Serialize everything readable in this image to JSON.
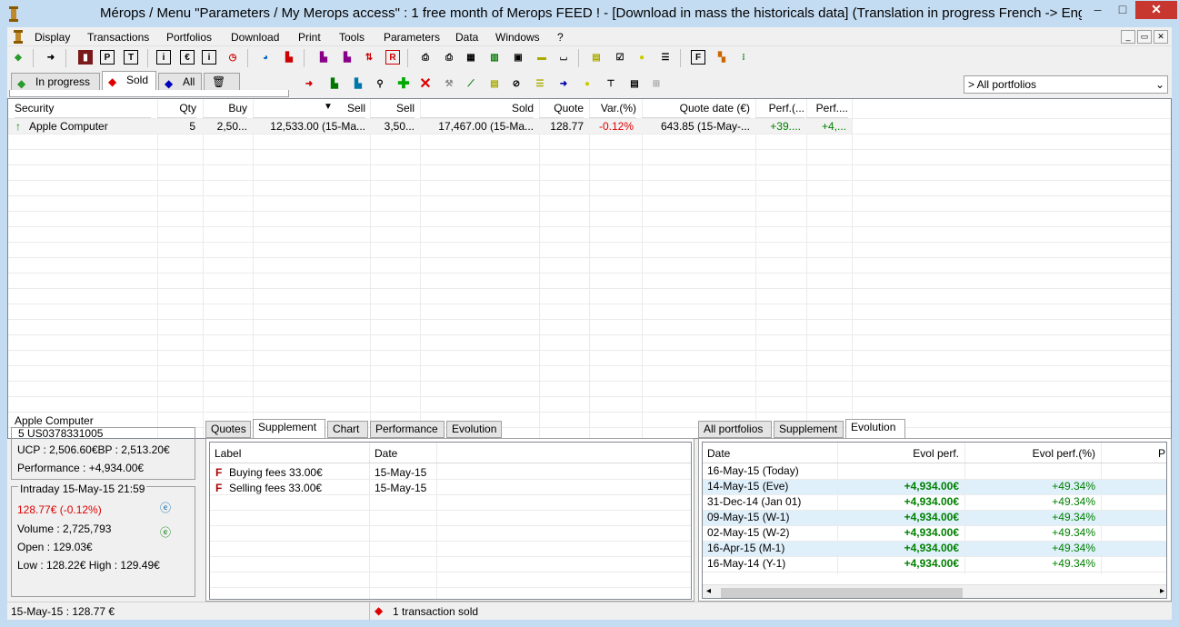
{
  "window": {
    "title": "Mérops / Menu \"Parameters / My Merops access\" : 1 free month of Merops FEED ! - [Download in mass the historicals data] (Translation in progress French -> Engl",
    "min_label": "–",
    "max_label": "□",
    "close_label": "✕"
  },
  "menu": [
    "Display",
    "Transactions",
    "Portfolios",
    "Download",
    "Print",
    "Tools",
    "Parameters",
    "Data",
    "Windows",
    "?"
  ],
  "mdi": {
    "min": "_",
    "restore": "▭",
    "close": "✕"
  },
  "tabs": [
    {
      "label": "In progress"
    },
    {
      "label": "Sold"
    },
    {
      "label": "All"
    }
  ],
  "portfolio_select": {
    "value": "> All portfolios"
  },
  "grid": {
    "headers": [
      "Security",
      "Qty",
      "Buy",
      "",
      "Sell",
      "Sell",
      "Sold",
      "Quote",
      "Var.(%)",
      "Quote date (€)",
      "Perf.(...",
      "Perf...."
    ],
    "row": {
      "security": "Apple Computer",
      "qty": "5",
      "buy": "2,50...",
      "buy_total": "12,533.00 (15-Ma...",
      "sell": "3,50...",
      "sold": "17,467.00 (15-Ma...",
      "quote": "128.77",
      "var": "-0.12%",
      "quote_date": "643.85 (15-May-...",
      "perf1": "+39....",
      "perf2": "+4,..."
    }
  },
  "info": {
    "name": "Apple Computer",
    "isin": "5 US0378331005",
    "ucp": "UCP : 2,506.60€BP : 2,513.20€",
    "performance": "Performance : +4,934.00€",
    "intraday": "Intraday 15-May-15 21:59",
    "quote": "128.77€ (-0.12%)",
    "volume": "Volume : 2,725,793",
    "open": "Open : 129.03€",
    "lowhigh": "Low : 128.22€ High : 129.49€"
  },
  "mid_tabs": [
    "Quotes",
    "Supplement",
    "Chart",
    "Performance",
    "Evolution"
  ],
  "mid_table": {
    "headers": [
      "Label",
      "Date"
    ],
    "rows": [
      {
        "label": "Buying fees 33.00€",
        "date": "15-May-15"
      },
      {
        "label": "Selling fees 33.00€",
        "date": "15-May-15"
      }
    ]
  },
  "right_tabs": [
    "All portfolios",
    "Supplement",
    "Evolution"
  ],
  "right_table": {
    "headers": [
      "Date",
      "Evol perf.",
      "Evol perf.(%)",
      "P"
    ],
    "rows": [
      {
        "date": "16-May-15 (Today)",
        "evol": "",
        "pct": ""
      },
      {
        "date": "14-May-15 (Eve)",
        "evol": "+4,934.00€",
        "pct": "+49.34%"
      },
      {
        "date": "31-Dec-14 (Jan 01)",
        "evol": "+4,934.00€",
        "pct": "+49.34%"
      },
      {
        "date": "09-May-15 (W-1)",
        "evol": "+4,934.00€",
        "pct": "+49.34%"
      },
      {
        "date": "02-May-15 (W-2)",
        "evol": "+4,934.00€",
        "pct": "+49.34%"
      },
      {
        "date": "16-Apr-15 (M-1)",
        "evol": "+4,934.00€",
        "pct": "+49.34%"
      },
      {
        "date": "16-May-14 (Y-1)",
        "evol": "+4,934.00€",
        "pct": "+49.34%"
      }
    ]
  },
  "status": {
    "left": "15-May-15 : 128.77 €",
    "center": "1 transaction sold"
  },
  "colors": {
    "accent": "#c4dcf2",
    "green": "#008000",
    "red": "#e00000",
    "highlight": "#dff0fb"
  }
}
